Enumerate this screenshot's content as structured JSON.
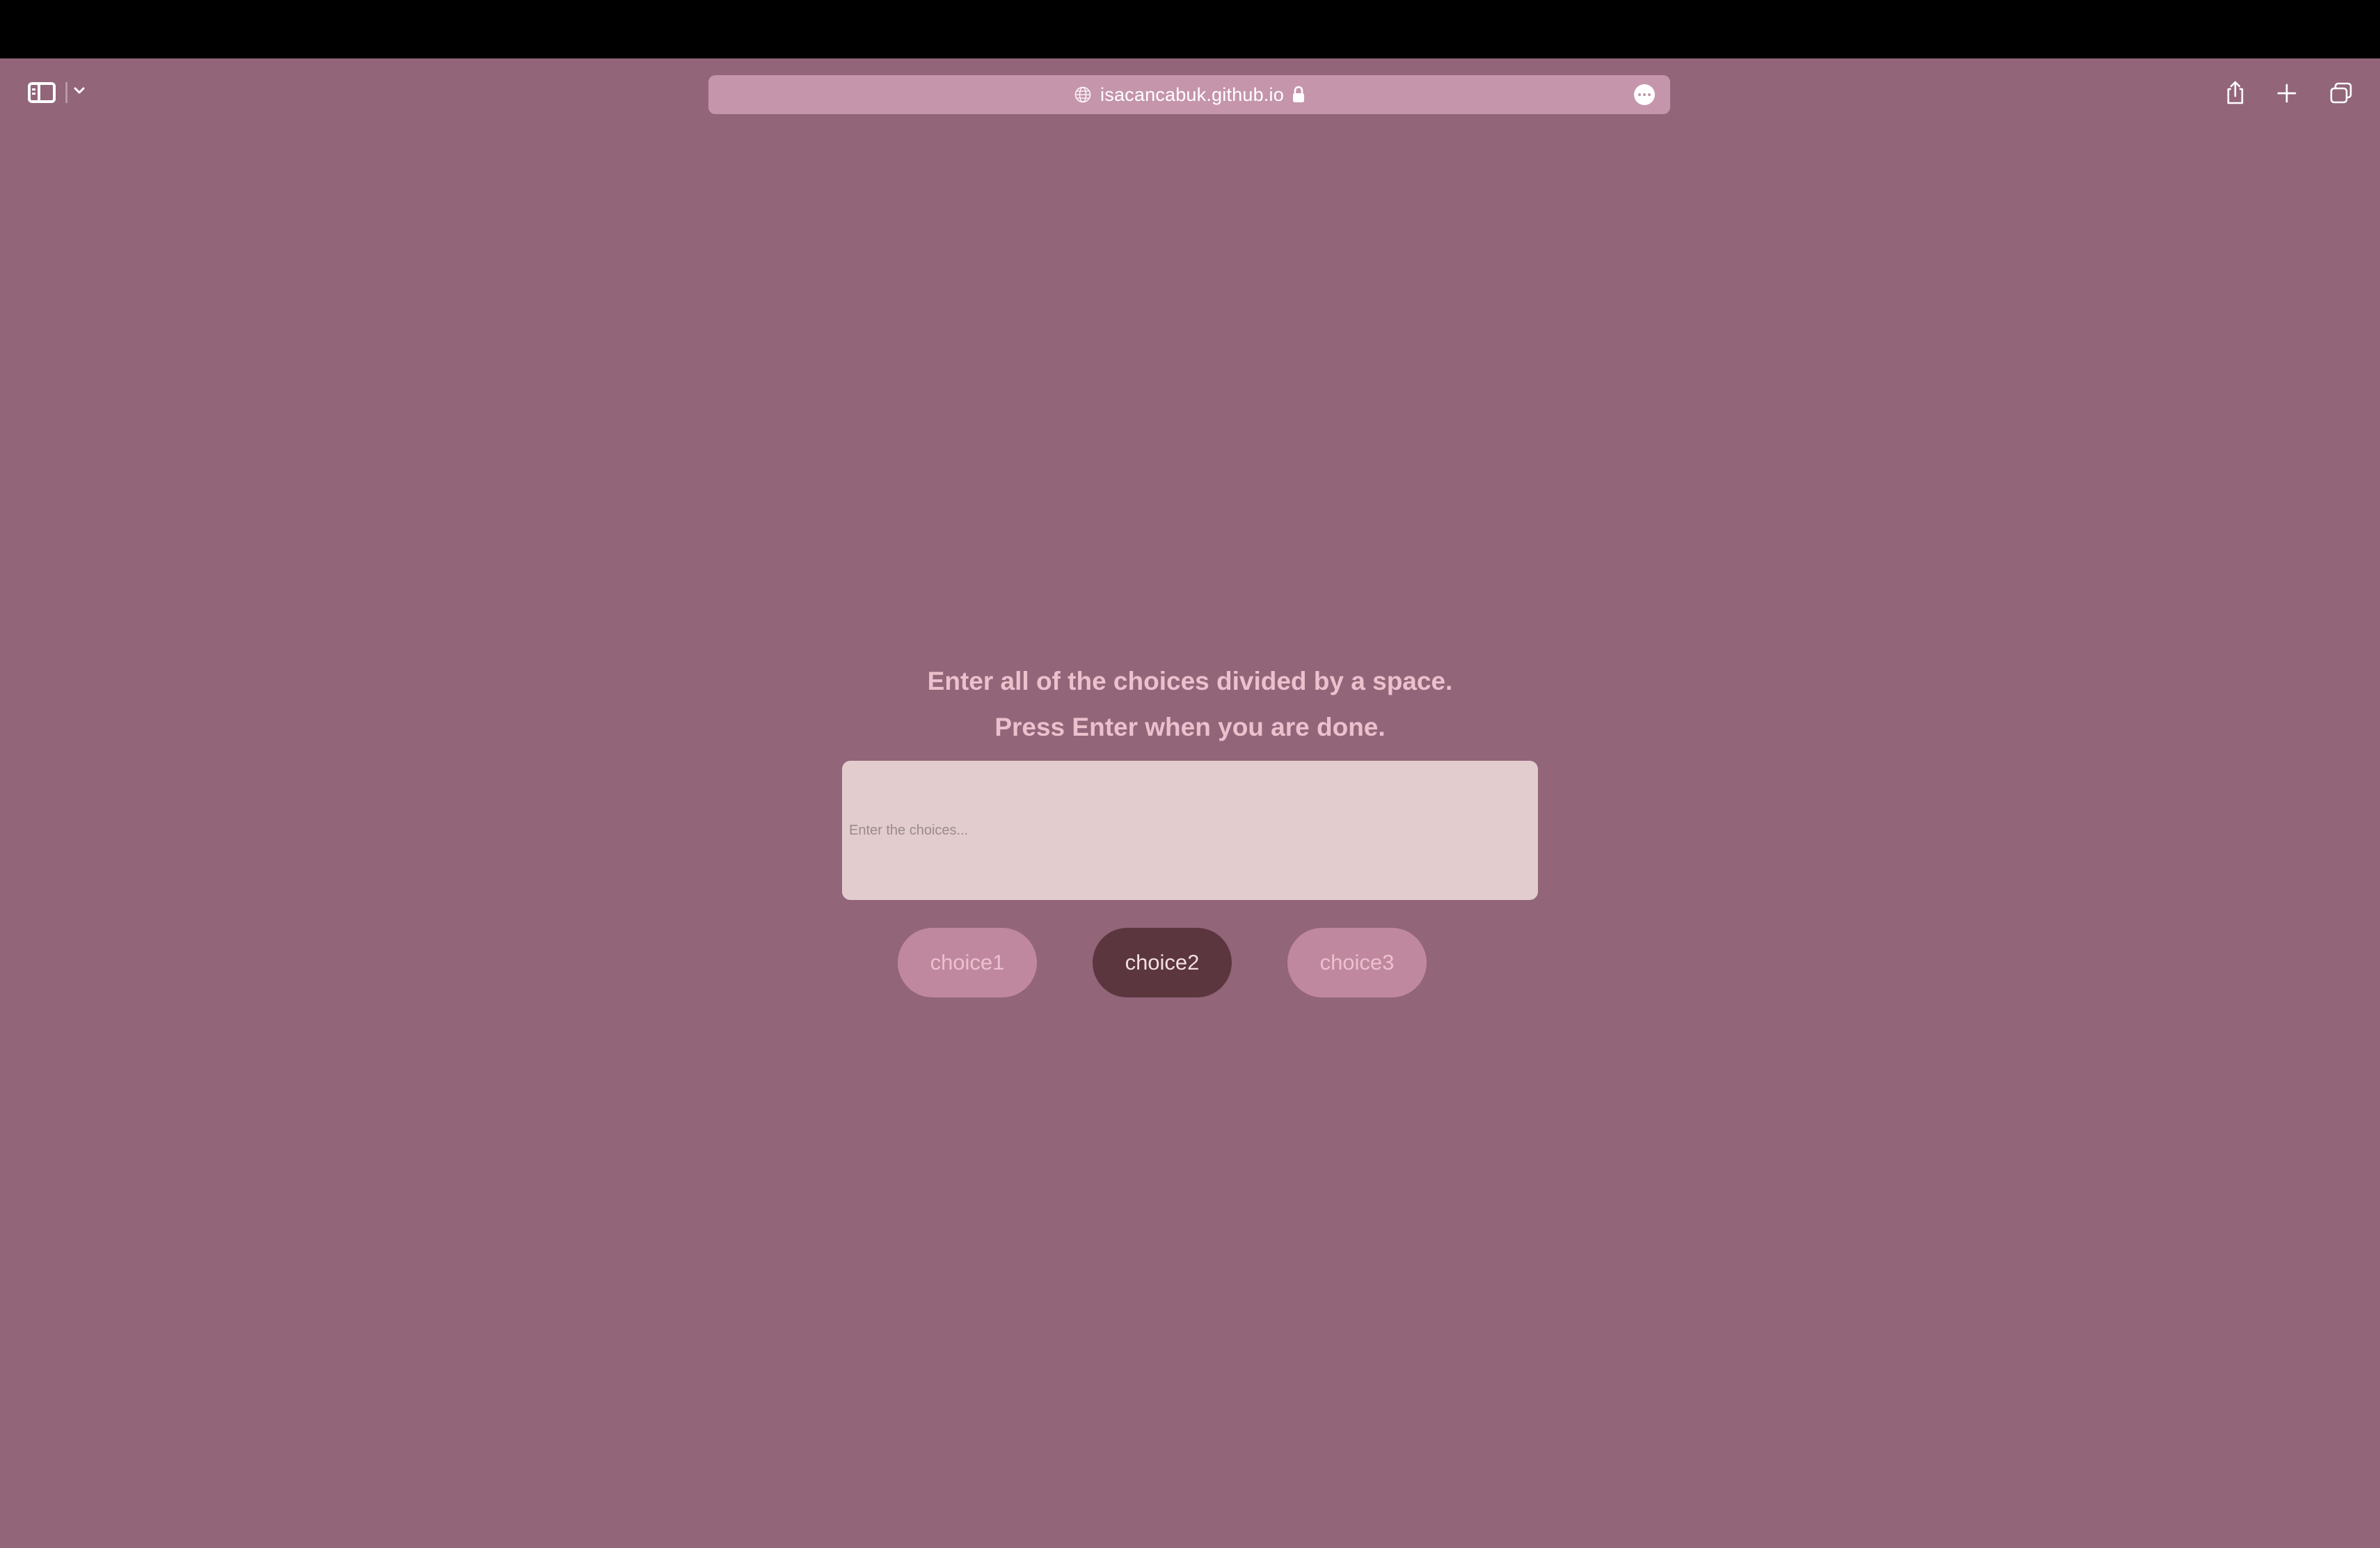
{
  "browser": {
    "url": "isacancabuk.github.io",
    "icons": {
      "sidebar": "sidebar-icon",
      "chevron": "chevron-down-icon",
      "globe": "globe-icon",
      "lock": "lock-icon",
      "more": "more-icon",
      "share": "share-icon",
      "new_tab": "plus-icon",
      "tabs": "tabs-overview-icon"
    }
  },
  "page": {
    "instruction_line1": "Enter all of the choices divided by a space.",
    "instruction_line2": "Press Enter when you are done.",
    "input_placeholder": "Enter the choices...",
    "input_value": "",
    "choices": [
      {
        "label": "choice1",
        "selected": false
      },
      {
        "label": "choice2",
        "selected": true
      },
      {
        "label": "choice3",
        "selected": false
      }
    ]
  },
  "colors": {
    "background": "#926579",
    "address_bar": "#c595ac",
    "text": "#ecc0cc",
    "input_bg": "#e3cccd",
    "choice_bg": "#c0889f",
    "choice_selected_bg": "#5b363f"
  }
}
